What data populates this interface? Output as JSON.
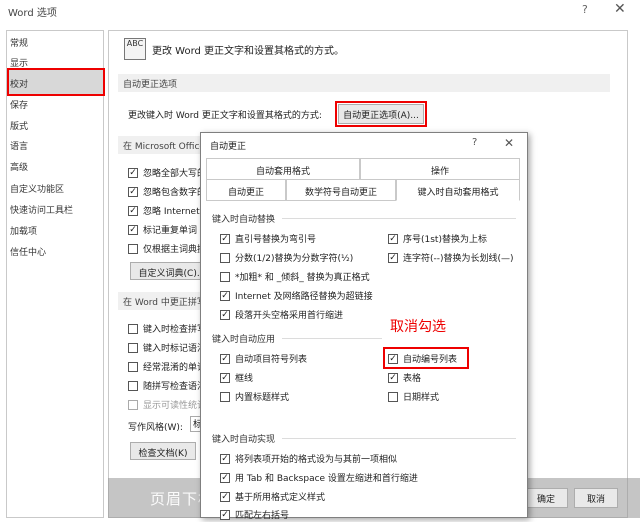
{
  "window": {
    "title": "Word 选项",
    "help": "?",
    "close": "✕"
  },
  "nav": {
    "items": [
      "常规",
      "显示",
      "校对",
      "保存",
      "版式",
      "语言",
      "高级",
      "自定义功能区",
      "快速访问工具栏",
      "加载项",
      "信任中心"
    ],
    "selected": "校对"
  },
  "main": {
    "header_icon": "abc-check-icon",
    "header_icon_text": "ABC",
    "header_text": "更改 Word 更正文字和设置其格式的方式。",
    "section1": "自动更正选项",
    "ac_label": "更改键入时 Word 更正文字和设置其格式的方式:",
    "ac_button": "自动更正选项(A)...",
    "section2": "在 Microsoft Office 程序中更正拼写时",
    "office_checks": [
      {
        "label": "忽略全部大写的单词",
        "checked": true
      },
      {
        "label": "忽略包含数字的单词",
        "checked": true
      },
      {
        "label": "忽略 Internet 和文件地址",
        "checked": true
      },
      {
        "label": "标记重复单词",
        "checked": true
      },
      {
        "label": "仅根据主词典提供建议",
        "checked": false
      }
    ],
    "custom_dict_button": "自定义词典(C)...",
    "section3": "在 Word 中更正拼写和语法时",
    "word_checks": [
      {
        "label": "键入时检查拼写",
        "checked": false,
        "disabled": false
      },
      {
        "label": "键入时标记语法错误",
        "checked": false,
        "disabled": false
      },
      {
        "label": "经常混淆的单词",
        "checked": false,
        "disabled": false
      },
      {
        "label": "随拼写检查语法",
        "checked": false,
        "disabled": false
      },
      {
        "label": "显示可读性统计信息",
        "checked": false,
        "disabled": true
      }
    ],
    "write_style_label": "写作风格(W):",
    "write_style_value": "标",
    "check_doc_button": "检查文档(K)",
    "ok_button": "确定",
    "cancel_button": "取消",
    "watermark": "页眉下横线怎么去掉(页眉的横线怎么去掉)"
  },
  "dialog": {
    "title": "自动更正",
    "help": "?",
    "close": "✕",
    "tabs_row1": [
      "自动套用格式",
      "操作"
    ],
    "tabs_row2": [
      "自动更正",
      "数学符号自动更正",
      "键入时自动套用格式"
    ],
    "active_tab": "键入时自动套用格式",
    "group1": "键入时自动替换",
    "group1_left": [
      {
        "label": "直引号替换为弯引号",
        "checked": true
      },
      {
        "label": "分数(1/2)替换为分数字符(½)",
        "checked": false
      },
      {
        "label": "*加粗* 和 _倾斜_ 替换为真正格式",
        "checked": false
      },
      {
        "label": "Internet 及网络路径替换为超链接",
        "checked": true
      },
      {
        "label": "段落开头空格采用首行缩进",
        "checked": true
      }
    ],
    "group1_right": [
      {
        "label": "序号(1st)替换为上标",
        "checked": true
      },
      {
        "label": "连字符(--)替换为长划线(—)",
        "checked": true
      }
    ],
    "group2": "键入时自动应用",
    "group2_left": [
      {
        "label": "自动项目符号列表",
        "checked": true
      },
      {
        "label": "框线",
        "checked": true
      },
      {
        "label": "内置标题样式",
        "checked": false
      }
    ],
    "group2_right": [
      {
        "label": "自动编号列表",
        "checked": true
      },
      {
        "label": "表格",
        "checked": true
      },
      {
        "label": "日期样式",
        "checked": false
      }
    ],
    "cancel_hint": "取消勾选",
    "group3": "键入时自动实现",
    "group3_items": [
      {
        "label": "将列表项开始的格式设为与其前一项相似",
        "checked": true
      },
      {
        "label": "用 Tab 和 Backspace 设置左缩进和首行缩进",
        "checked": true
      },
      {
        "label": "基于所用格式定义样式",
        "checked": true
      },
      {
        "label": "匹配左右括号",
        "checked": true
      }
    ]
  },
  "colors": {
    "highlight": "#e00000",
    "nav_selected": "#d8d8d8",
    "section_bar": "#f0f0f0"
  }
}
